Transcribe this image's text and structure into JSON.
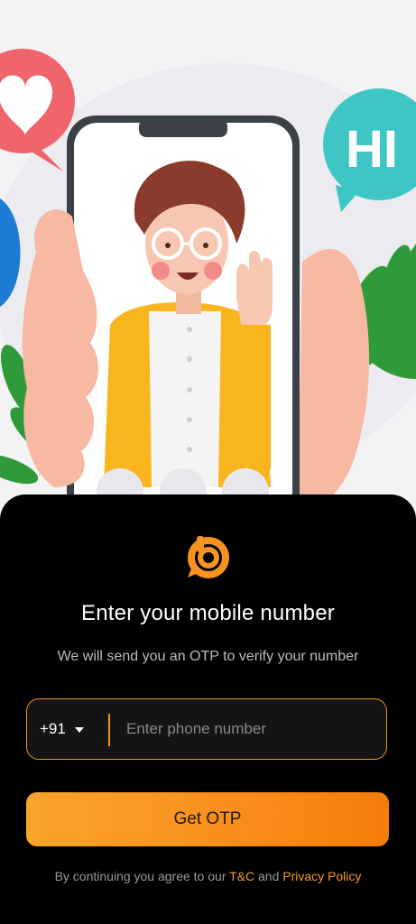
{
  "onboarding": {
    "title": "Enter your mobile number",
    "subtitle": "We will send you an OTP to verify your number",
    "country_code": "+91",
    "phone_placeholder": "Enter phone number",
    "phone_value": "",
    "cta_label": "Get OTP",
    "terms_prefix": "By continuing you agree to our ",
    "terms_link": "T&C",
    "terms_and": " and ",
    "privacy_link": "Privacy Policy"
  },
  "illustration": {
    "bubble_right_text": "HI"
  },
  "colors": {
    "accent": "#F7931E",
    "sheet_background": "#000000",
    "hero_background": "#F3F3F6",
    "heart_bubble": "#F0646C",
    "hi_bubble": "#3EC6C4",
    "jacket": "#F8B51E"
  },
  "icons": [
    "brand-logo-icon",
    "chevron-down-icon",
    "heart-icon",
    "hand-wave-icon"
  ]
}
